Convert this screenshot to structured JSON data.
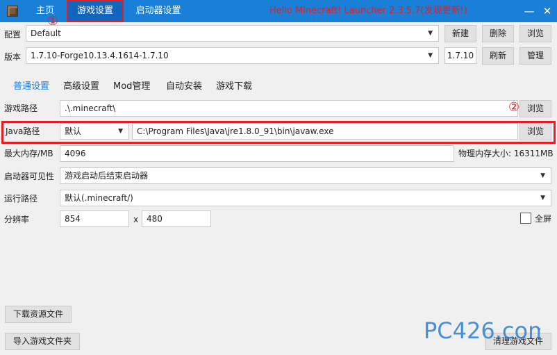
{
  "titlebar": {
    "tabs": [
      {
        "label": "主页"
      },
      {
        "label": "游戏设置"
      },
      {
        "label": "启动器设置"
      }
    ],
    "title": "Hello Minecraft! Launcher 2.3.5.7(发现更新!)",
    "minimize": "—",
    "close": "✕"
  },
  "markers": {
    "one": "①",
    "two": "②"
  },
  "profile": {
    "label": "配置",
    "value": "Default",
    "new_btn": "新建",
    "delete_btn": "删除",
    "browse_btn": "浏览"
  },
  "version": {
    "label": "版本",
    "value": "1.7.10-Forge10.13.4.1614-1.7.10",
    "short": "1.7.10",
    "refresh_btn": "刷新",
    "manage_btn": "管理"
  },
  "subtabs": [
    {
      "label": "普通设置"
    },
    {
      "label": "高级设置"
    },
    {
      "label": "Mod管理"
    },
    {
      "label": "自动安装"
    },
    {
      "label": "游戏下载"
    }
  ],
  "game_path": {
    "label": "游戏路径",
    "value": ".\\.minecraft\\",
    "browse_btn": "浏览"
  },
  "java_path": {
    "label": "Java路径",
    "mode": "默认",
    "value": "C:\\Program Files\\Java\\jre1.8.0_91\\bin\\javaw.exe",
    "browse_btn": "浏览"
  },
  "memory": {
    "label": "最大内存/MB",
    "value": "4096",
    "physical": "物理内存大小: 16311MB"
  },
  "visibility": {
    "label": "启动器可见性",
    "value": "游戏启动后结束启动器"
  },
  "run_path": {
    "label": "运行路径",
    "value": "默认(.minecraft/)"
  },
  "resolution": {
    "label": "分辨率",
    "width": "854",
    "x": "x",
    "height": "480",
    "fullscreen": "全屏"
  },
  "buttons": {
    "download_assets": "下载资源文件",
    "import_folder": "导入游戏文件夹",
    "clean_files": "清理游戏文件"
  },
  "watermark": {
    "text": "PC426.com"
  }
}
